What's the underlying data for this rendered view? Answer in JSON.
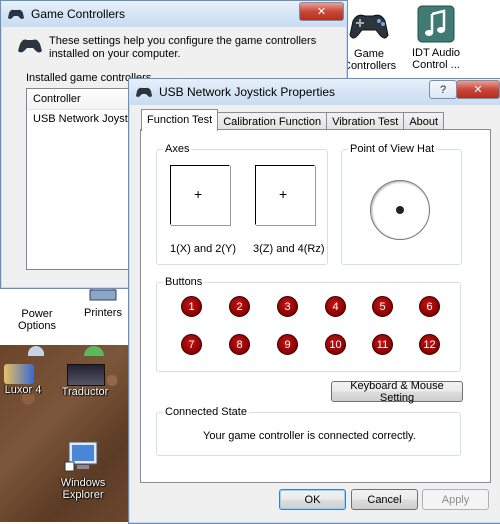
{
  "explorer": {
    "icons": [
      {
        "label_line1": "Game",
        "label_line2": "Controllers"
      },
      {
        "label_line1": "IDT Audio",
        "label_line2": "Control ..."
      },
      {
        "label_line1": "Power",
        "label_line2": "Options"
      },
      {
        "label_line1": "Printers",
        "label_line2": ""
      }
    ]
  },
  "desktop": {
    "icons": [
      {
        "label": "Luxor 4"
      },
      {
        "label": "Traductor"
      },
      {
        "label_line1": "Windows",
        "label_line2": "Explorer"
      }
    ]
  },
  "game_controllers": {
    "title": "Game Controllers",
    "close_glyph": "✕",
    "description": "These settings help you configure the game controllers installed on your computer.",
    "installed_label": "Installed game controllers",
    "column_controller": "Controller",
    "row_controller": "USB Network Joystick"
  },
  "properties": {
    "title": "USB Network Joystick Properties",
    "help_glyph": "?",
    "close_glyph": "✕",
    "tabs": [
      "Function Test",
      "Calibration Function",
      "Vibration Test",
      "About"
    ],
    "active_tab": "Function Test",
    "axes_label": "Axes",
    "axis1_caption": "1(X) and 2(Y)",
    "axis2_caption": "3(Z) and 4(Rz)",
    "pov_label": "Point of View Hat",
    "buttons_label": "Buttons",
    "buttons": [
      "1",
      "2",
      "3",
      "4",
      "5",
      "6",
      "7",
      "8",
      "9",
      "10",
      "11",
      "12"
    ],
    "keyboard_mouse_button": "Keyboard & Mouse Setting",
    "connected_state_label": "Connected State",
    "connected_state_text": "Your game controller is connected correctly.",
    "ok": "OK",
    "cancel": "Cancel",
    "apply": "Apply"
  }
}
